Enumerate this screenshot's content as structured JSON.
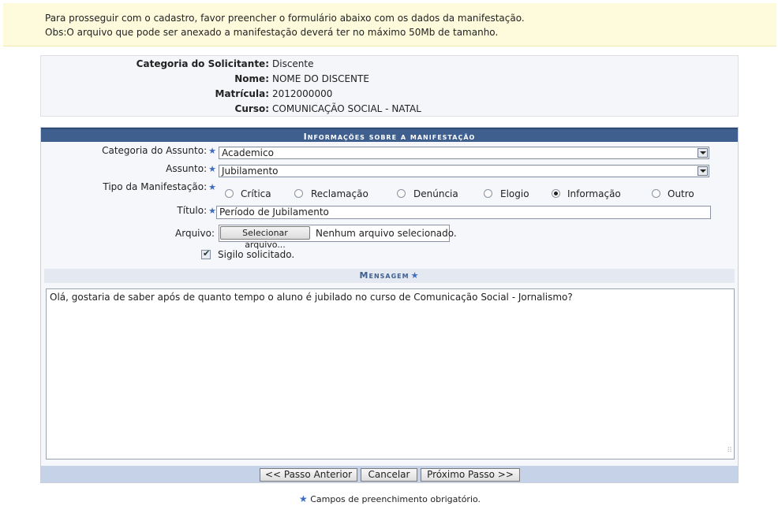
{
  "notice": {
    "line1": "Para prosseguir com o cadastro, favor preencher o formulário abaixo com os dados da manifestação.",
    "line2": "Obs:O arquivo que pode ser anexado a manifestação deverá ter no máximo 50Mb de tamanho."
  },
  "student": [
    {
      "label": "Categoria do Solicitante:",
      "value": "Discente"
    },
    {
      "label": "Nome:",
      "value": "NOME DO DISCENTE"
    },
    {
      "label": "Matrícula:",
      "value": "2012000000"
    },
    {
      "label": "Curso:",
      "value": "COMUNICAÇÃO SOCIAL - NATAL"
    }
  ],
  "form": {
    "title": "Informações sobre a manifestação",
    "categoria_label": "Categoria do Assunto:",
    "categoria_value": "Academico",
    "assunto_label": "Assunto:",
    "assunto_value": "Jubilamento",
    "tipo_label": "Tipo da Manifestação:",
    "tipo_options": [
      "Crítica",
      "Reclamação",
      "Denúncia",
      "Elogio",
      "Informação",
      "Outro"
    ],
    "tipo_selected": "Informação",
    "titulo_label": "Título:",
    "titulo_value": "Período de Jubilamento",
    "arquivo_label": "Arquivo:",
    "arquivo_button": "Selecionar arquivo...",
    "arquivo_status": "Nenhum arquivo selecionado.",
    "sigilo_label": "Sigilo solicitado.",
    "sigilo_checked": true,
    "mensagem_title": "Mensagem",
    "mensagem_value": "Olá, gostaria de saber após de quanto tempo o aluno é jubilado no curso de Comunicação Social - Jornalismo?",
    "required_mark": "★"
  },
  "buttons": {
    "back": "<< Passo Anterior",
    "cancel": "Cancelar",
    "next": "Próximo Passo >>"
  },
  "legend": {
    "mark": "★",
    "text": " Campos de preenchimento obrigatório."
  },
  "colors": {
    "header_bg": "#3f5f8f",
    "notice_bg": "#fefbdc",
    "required_star": "#3d6cc0"
  }
}
